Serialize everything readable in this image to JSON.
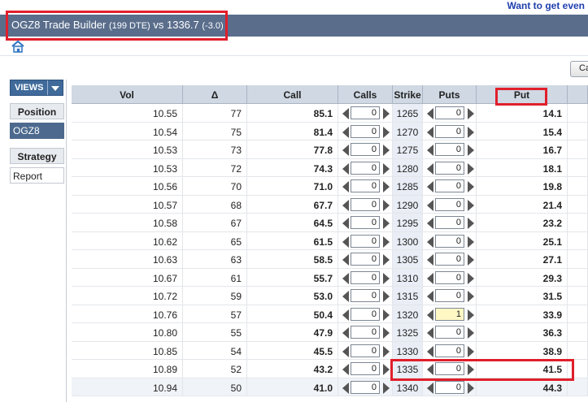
{
  "header": {
    "top_link": "Want to get even",
    "symbol": "OGZ8",
    "trade_builder": "Trade Builder",
    "dte": "(199 DTE)",
    "vs": "vs",
    "price": "1336.7",
    "change": "(-3.0)"
  },
  "toolbar": {
    "right_button_label": "Ca"
  },
  "sidebar": {
    "views_label": "VIEWS",
    "items": [
      {
        "label": "Position",
        "style": "button"
      },
      {
        "label": "OGZ8",
        "style": "active"
      },
      {
        "label": "Strategy",
        "style": "button"
      },
      {
        "label": "Report",
        "style": "plain"
      }
    ]
  },
  "table": {
    "columns": [
      "Vol",
      "Δ",
      "Call",
      "Calls",
      "Strike",
      "Puts",
      "Put"
    ],
    "rows": [
      {
        "vol": "10.55",
        "delta": "77",
        "call": "85.1",
        "calls": "0",
        "strike": "1265",
        "puts": "0",
        "put": "14.1"
      },
      {
        "vol": "10.54",
        "delta": "75",
        "call": "81.4",
        "calls": "0",
        "strike": "1270",
        "puts": "0",
        "put": "15.4"
      },
      {
        "vol": "10.53",
        "delta": "73",
        "call": "77.8",
        "calls": "0",
        "strike": "1275",
        "puts": "0",
        "put": "16.7"
      },
      {
        "vol": "10.53",
        "delta": "72",
        "call": "74.3",
        "calls": "0",
        "strike": "1280",
        "puts": "0",
        "put": "18.1"
      },
      {
        "vol": "10.56",
        "delta": "70",
        "call": "71.0",
        "calls": "0",
        "strike": "1285",
        "puts": "0",
        "put": "19.8"
      },
      {
        "vol": "10.57",
        "delta": "68",
        "call": "67.7",
        "calls": "0",
        "strike": "1290",
        "puts": "0",
        "put": "21.4"
      },
      {
        "vol": "10.58",
        "delta": "67",
        "call": "64.5",
        "calls": "0",
        "strike": "1295",
        "puts": "0",
        "put": "23.2"
      },
      {
        "vol": "10.62",
        "delta": "65",
        "call": "61.5",
        "calls": "0",
        "strike": "1300",
        "puts": "0",
        "put": "25.1"
      },
      {
        "vol": "10.63",
        "delta": "63",
        "call": "58.5",
        "calls": "0",
        "strike": "1305",
        "puts": "0",
        "put": "27.1"
      },
      {
        "vol": "10.67",
        "delta": "61",
        "call": "55.7",
        "calls": "0",
        "strike": "1310",
        "puts": "0",
        "put": "29.3"
      },
      {
        "vol": "10.72",
        "delta": "59",
        "call": "53.0",
        "calls": "0",
        "strike": "1315",
        "puts": "0",
        "put": "31.5"
      },
      {
        "vol": "10.76",
        "delta": "57",
        "call": "50.4",
        "calls": "0",
        "strike": "1320",
        "puts": "1",
        "put": "33.9",
        "puts_highlight": true
      },
      {
        "vol": "10.80",
        "delta": "55",
        "call": "47.9",
        "calls": "0",
        "strike": "1325",
        "puts": "0",
        "put": "36.3"
      },
      {
        "vol": "10.85",
        "delta": "54",
        "call": "45.5",
        "calls": "0",
        "strike": "1330",
        "puts": "0",
        "put": "38.9"
      },
      {
        "vol": "10.89",
        "delta": "52",
        "call": "43.2",
        "calls": "0",
        "strike": "1335",
        "puts": "0",
        "put": "41.5",
        "atm": true
      },
      {
        "vol": "10.94",
        "delta": "50",
        "call": "41.0",
        "calls": "0",
        "strike": "1340",
        "puts": "0",
        "put": "44.3",
        "partial": true
      }
    ]
  },
  "colors": {
    "title_bar": "#5a6e8c",
    "header_bg": "#cfd8e3",
    "highlight_box": "#e01f2b",
    "qty_highlight": "#fff7c4"
  }
}
